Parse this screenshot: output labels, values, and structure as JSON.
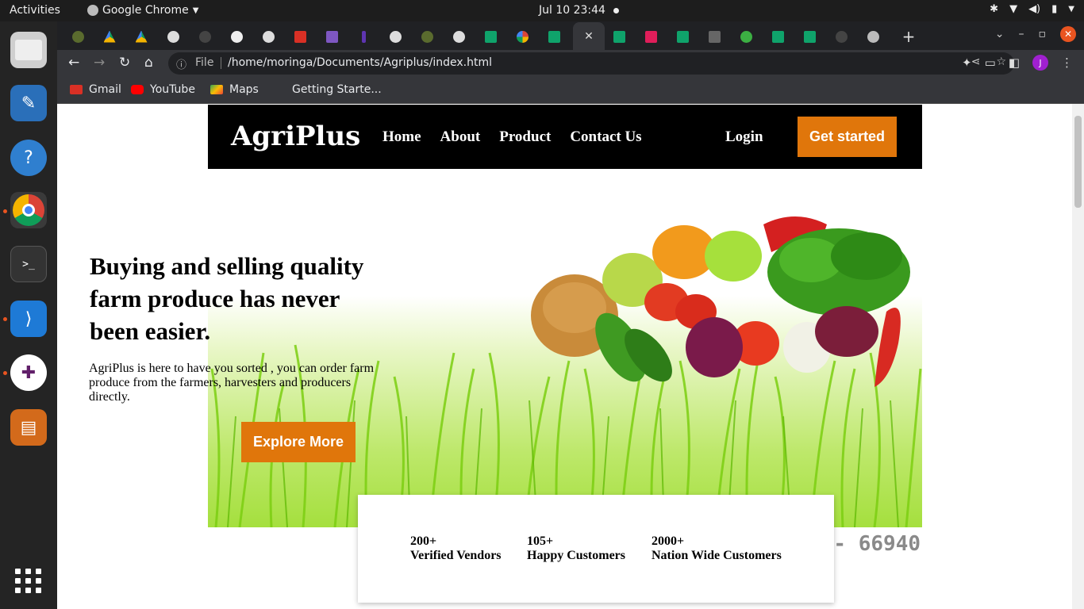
{
  "system": {
    "activities": "Activities",
    "app_name": "Google Chrome",
    "clock": "Jul 10  23:44"
  },
  "browser": {
    "url_scheme_label": "File",
    "url": "/home/moringa/Documents/Agriplus/index.html",
    "profile_initial": "J",
    "bookmarks": [
      "Gmail",
      "YouTube",
      "Maps",
      "Getting Starte..."
    ]
  },
  "site": {
    "logo": "AgriPlus",
    "nav": [
      "Home",
      "About",
      "Product",
      "Contact Us"
    ],
    "login": "Login",
    "cta": "Get started",
    "hero": {
      "title": "Buying and selling quality farm produce has never been easier.",
      "text": "AgriPlus is here to have you sorted , you can order farm produce from the farmers, harvesters and producers directly.",
      "button": "Explore More",
      "watermark": "- 66940"
    },
    "stats": [
      {
        "value": "200+",
        "label": "Verified Vendors"
      },
      {
        "value": "105+",
        "label": "Happy Customers"
      },
      {
        "value": "2000+",
        "label": "Nation Wide Customers"
      }
    ]
  },
  "colors": {
    "accent": "#e0760b",
    "nav_bg": "#000000"
  }
}
